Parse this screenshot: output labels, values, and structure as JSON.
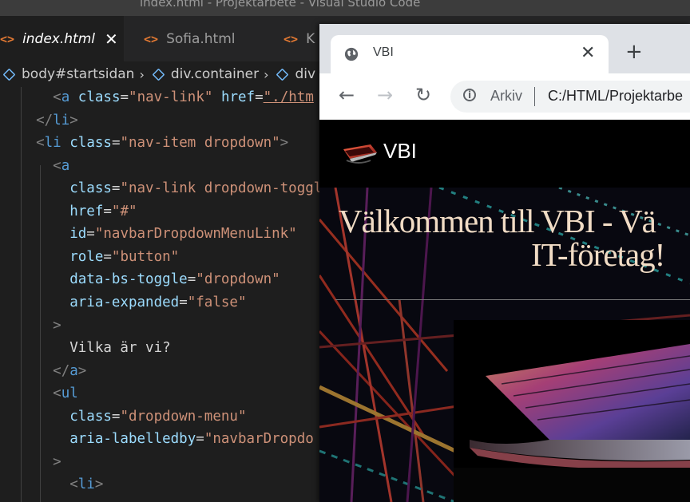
{
  "vscode": {
    "window_title": "index.html - Projektarbete - Visual Studio Code",
    "tabs": [
      {
        "label": "index.html",
        "icon": "code-icon",
        "active": true,
        "close": "✕"
      },
      {
        "label": "Sofia.html",
        "icon": "code-icon",
        "active": false
      },
      {
        "label": "K",
        "icon": "code-icon",
        "active": false
      }
    ],
    "tab_icon_glyph": "<>",
    "breadcrumbs": [
      "body#startsidan",
      "div.container",
      "div"
    ],
    "code_lines": [
      {
        "indent": "    ",
        "segments": [
          [
            "tk-brk",
            "<"
          ],
          [
            "tk-tag",
            "a"
          ],
          [
            "tk-txt",
            " "
          ],
          [
            "tk-attr",
            "class"
          ],
          [
            "tk-txt",
            "="
          ],
          [
            "tk-str",
            "\"nav-link\""
          ],
          [
            "tk-txt",
            " "
          ],
          [
            "tk-attr",
            "href"
          ],
          [
            "tk-txt",
            "="
          ],
          [
            "tk-str tk-link",
            "\"./htm"
          ]
        ]
      },
      {
        "indent": "  ",
        "segments": [
          [
            "tk-brk",
            "</"
          ],
          [
            "tk-tag",
            "li"
          ],
          [
            "tk-brk",
            ">"
          ]
        ]
      },
      {
        "indent": "  ",
        "segments": [
          [
            "tk-brk",
            "<"
          ],
          [
            "tk-tag",
            "li"
          ],
          [
            "tk-txt",
            " "
          ],
          [
            "tk-attr",
            "class"
          ],
          [
            "tk-txt",
            "="
          ],
          [
            "tk-str",
            "\"nav-item dropdown\""
          ],
          [
            "tk-brk",
            ">"
          ]
        ]
      },
      {
        "indent": "    ",
        "segments": [
          [
            "tk-brk",
            "<"
          ],
          [
            "tk-tag",
            "a"
          ]
        ]
      },
      {
        "indent": "      ",
        "segments": [
          [
            "tk-attr",
            "class"
          ],
          [
            "tk-txt",
            "="
          ],
          [
            "tk-str",
            "\"nav-link dropdown-toggle"
          ]
        ]
      },
      {
        "indent": "      ",
        "segments": [
          [
            "tk-attr",
            "href"
          ],
          [
            "tk-txt",
            "="
          ],
          [
            "tk-str",
            "\"#\""
          ]
        ]
      },
      {
        "indent": "      ",
        "segments": [
          [
            "tk-attr",
            "id"
          ],
          [
            "tk-txt",
            "="
          ],
          [
            "tk-str",
            "\"navbarDropdownMenuLink\""
          ]
        ]
      },
      {
        "indent": "      ",
        "segments": [
          [
            "tk-attr",
            "role"
          ],
          [
            "tk-txt",
            "="
          ],
          [
            "tk-str",
            "\"button\""
          ]
        ]
      },
      {
        "indent": "      ",
        "segments": [
          [
            "tk-attr",
            "data-bs-toggle"
          ],
          [
            "tk-txt",
            "="
          ],
          [
            "tk-str",
            "\"dropdown\""
          ]
        ]
      },
      {
        "indent": "      ",
        "segments": [
          [
            "tk-attr",
            "aria-expanded"
          ],
          [
            "tk-txt",
            "="
          ],
          [
            "tk-str",
            "\"false\""
          ]
        ]
      },
      {
        "indent": "    ",
        "segments": [
          [
            "tk-brk",
            ">"
          ]
        ]
      },
      {
        "indent": "      ",
        "segments": [
          [
            "tk-txt",
            "Vilka är vi?"
          ]
        ]
      },
      {
        "indent": "    ",
        "segments": [
          [
            "tk-brk",
            "</"
          ],
          [
            "tk-tag",
            "a"
          ],
          [
            "tk-brk",
            ">"
          ]
        ]
      },
      {
        "indent": "    ",
        "segments": [
          [
            "tk-brk",
            "<"
          ],
          [
            "tk-tag",
            "ul"
          ]
        ]
      },
      {
        "indent": "      ",
        "segments": [
          [
            "tk-attr",
            "class"
          ],
          [
            "tk-txt",
            "="
          ],
          [
            "tk-str",
            "\"dropdown-menu\""
          ]
        ]
      },
      {
        "indent": "      ",
        "segments": [
          [
            "tk-attr",
            "aria-labelledby"
          ],
          [
            "tk-txt",
            "="
          ],
          [
            "tk-str",
            "\"navbarDropdo"
          ]
        ]
      },
      {
        "indent": "    ",
        "segments": [
          [
            "tk-brk",
            ">"
          ]
        ]
      },
      {
        "indent": "      ",
        "segments": [
          [
            "tk-brk",
            "<"
          ],
          [
            "tk-tag",
            "li"
          ],
          [
            "tk-brk",
            ">"
          ]
        ]
      }
    ]
  },
  "chrome": {
    "tab_title": "VBI",
    "tab_close": "✕",
    "new_tab": "+",
    "back": "←",
    "forward": "→",
    "reload": "↻",
    "omnibox_label": "Arkiv",
    "omnibox_url": "C:/HTML/Projektarbe",
    "info_glyph": "i"
  },
  "site": {
    "brand": "VBI",
    "hero_title_line1": "Välkommen till VBI - Vä",
    "hero_title_line2": "IT-företag!"
  },
  "colors": {
    "vscode_bg": "#1e1e1e",
    "tag": "#569cd6",
    "attr": "#9cdcfe",
    "string": "#ce9178",
    "hero_text": "#f1dcc5",
    "tab_icon": "#e37933"
  }
}
